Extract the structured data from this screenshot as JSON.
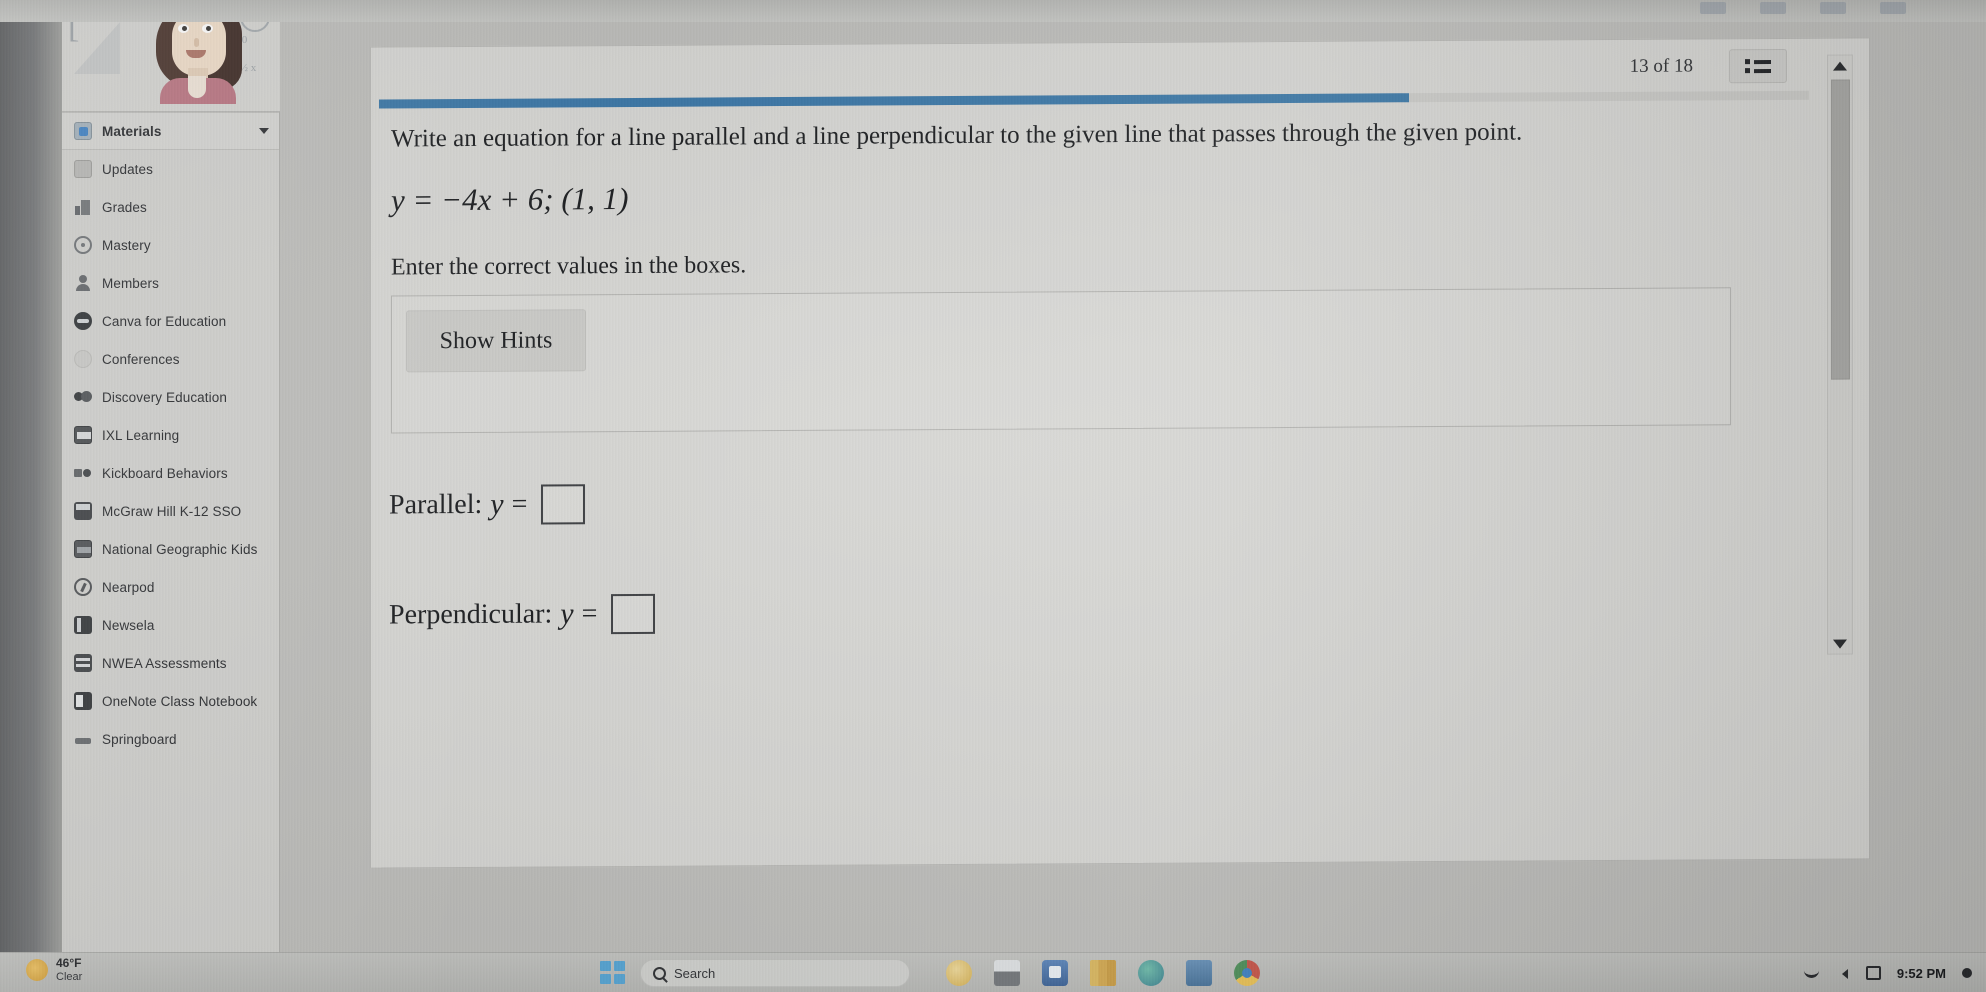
{
  "course": {
    "avatar_alt": "student-avatar",
    "banner_symbols": [
      "[",
      "b=0",
      "y=½ x"
    ]
  },
  "sidebar": {
    "items": [
      {
        "label": "Materials",
        "icon": "materials-icon",
        "active": true,
        "has_chevron": true
      },
      {
        "label": "Updates",
        "icon": "updates-icon",
        "active": false,
        "has_chevron": false
      },
      {
        "label": "Grades",
        "icon": "grades-icon",
        "active": false,
        "has_chevron": false
      },
      {
        "label": "Mastery",
        "icon": "mastery-icon",
        "active": false,
        "has_chevron": false
      },
      {
        "label": "Members",
        "icon": "members-icon",
        "active": false,
        "has_chevron": false
      },
      {
        "label": "Canva for Education",
        "icon": "canva-icon",
        "active": false,
        "has_chevron": false
      },
      {
        "label": "Conferences",
        "icon": "conferences-icon",
        "active": false,
        "has_chevron": false
      },
      {
        "label": "Discovery Education",
        "icon": "discovery-education-icon",
        "active": false,
        "has_chevron": false
      },
      {
        "label": "IXL Learning",
        "icon": "ixl-learning-icon",
        "active": false,
        "has_chevron": false
      },
      {
        "label": "Kickboard Behaviors",
        "icon": "kickboard-icon",
        "active": false,
        "has_chevron": false
      },
      {
        "label": "McGraw Hill K-12 SSO",
        "icon": "mcgraw-hill-icon",
        "active": false,
        "has_chevron": false
      },
      {
        "label": "National Geographic Kids",
        "icon": "national-geographic-icon",
        "active": false,
        "has_chevron": false
      },
      {
        "label": "Nearpod",
        "icon": "nearpod-icon",
        "active": false,
        "has_chevron": false
      },
      {
        "label": "Newsela",
        "icon": "newsela-icon",
        "active": false,
        "has_chevron": false
      },
      {
        "label": "NWEA Assessments",
        "icon": "nwea-icon",
        "active": false,
        "has_chevron": false
      },
      {
        "label": "OneNote Class Notebook",
        "icon": "onenote-icon",
        "active": false,
        "has_chevron": false
      },
      {
        "label": "Springboard",
        "icon": "springboard-icon",
        "active": false,
        "has_chevron": false
      }
    ]
  },
  "assignment": {
    "page_counter": "13 of 18",
    "progress_percent": 72,
    "progress_color": "#2f77b0",
    "prompt": "Write an equation for a line parallel and a line perpendicular to the given line that passes through the given point.",
    "equation": "y = −4x + 6; (1, 1)",
    "instruction": "Enter the correct values in the boxes.",
    "hints_button_label": "Show Hints",
    "answers": [
      {
        "label": "Parallel:",
        "variable": "y",
        "operator": "=",
        "value": ""
      },
      {
        "label": "Perpendicular:",
        "variable": "y",
        "operator": "=",
        "value": ""
      }
    ]
  },
  "taskbar": {
    "weather_temp": "46°F",
    "weather_condition": "Clear",
    "search_placeholder": "Search",
    "clock": "9:52 PM",
    "apps": [
      {
        "name": "copilot-icon",
        "cls": "app-ai"
      },
      {
        "name": "file-explorer-icon",
        "cls": "app-explorer"
      },
      {
        "name": "microsoft-store-icon",
        "cls": "app-store"
      },
      {
        "name": "books-icon",
        "cls": "app-books"
      },
      {
        "name": "earth-icon",
        "cls": "app-earth"
      },
      {
        "name": "toolbox-icon",
        "cls": "app-bag"
      },
      {
        "name": "chrome-icon",
        "cls": "app-chrome"
      }
    ]
  }
}
